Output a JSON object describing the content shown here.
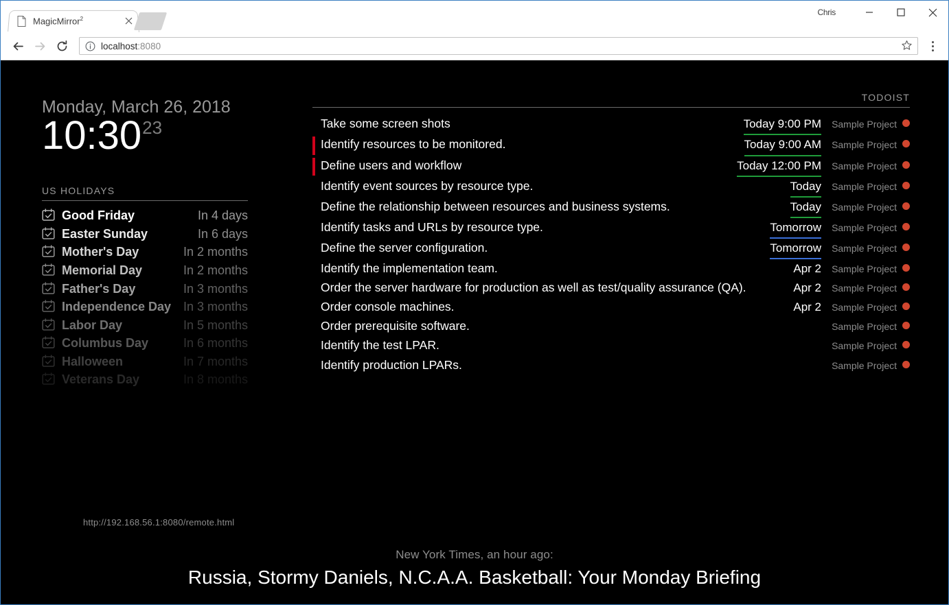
{
  "browser": {
    "tab": {
      "title": "MagicMirror",
      "superscript": "2",
      "page_icon": "page-icon",
      "close_icon": "close-icon"
    },
    "newtab_label": "",
    "profile_name": "Chris",
    "window_controls": {
      "minimize": "minimize-icon",
      "maximize": "maximize-icon",
      "close": "close-icon"
    },
    "toolbar": {
      "back_icon": "back-arrow-icon",
      "forward_icon": "forward-arrow-icon",
      "reload_icon": "reload-icon",
      "site_info_icon": "info-circle-icon",
      "url_host": "localhost",
      "url_port": ":8080",
      "bookmark_icon": "star-icon",
      "menu_icon": "three-dots-menu-icon"
    }
  },
  "mirror": {
    "clock": {
      "date": "Monday, March 26, 2018",
      "time": "10:30",
      "seconds": "23"
    },
    "calendar": {
      "header": "US Holidays",
      "icon_name": "calendar-check-icon",
      "events": [
        {
          "title": "Good Friday",
          "when": "In 4 days",
          "opacity": "1.00"
        },
        {
          "title": "Easter Sunday",
          "when": "In 6 days",
          "opacity": "0.92"
        },
        {
          "title": "Mother's Day",
          "when": "In 2 months",
          "opacity": "0.84"
        },
        {
          "title": "Memorial Day",
          "when": "In 2 months",
          "opacity": "0.75"
        },
        {
          "title": "Father's Day",
          "when": "In 3 months",
          "opacity": "0.64"
        },
        {
          "title": "Independence Day",
          "when": "In 3 months",
          "opacity": "0.53"
        },
        {
          "title": "Labor Day",
          "when": "In 5 months",
          "opacity": "0.43"
        },
        {
          "title": "Columbus Day",
          "when": "In 6 months",
          "opacity": "0.34"
        },
        {
          "title": "Halloween",
          "when": "In 7 months",
          "opacity": "0.25"
        },
        {
          "title": "Veterans Day",
          "when": "In 8 months",
          "opacity": "0.16"
        }
      ]
    },
    "remote_url": "http://192.168.56.1:8080/remote.html",
    "todoist": {
      "header": "Todoist",
      "project_dot_color": "#d1462f",
      "today_underline_color": "#1f9c3a",
      "tomorrow_underline_color": "#3a6fd8",
      "overdue_flag_color": "#d0021b",
      "tasks": [
        {
          "title": "Take some screen shots",
          "due": "Today 9:00 PM",
          "due_style": "today",
          "project": "Sample Project",
          "overdue": "false"
        },
        {
          "title": "Identify resources to be monitored.",
          "due": "Today 9:00 AM",
          "due_style": "today",
          "project": "Sample Project",
          "overdue": "true"
        },
        {
          "title": "Define users and workflow",
          "due": "Today 12:00 PM",
          "due_style": "today",
          "project": "Sample Project",
          "overdue": "true"
        },
        {
          "title": "Identify event sources by resource type.",
          "due": "Today",
          "due_style": "today",
          "project": "Sample Project",
          "overdue": "false"
        },
        {
          "title": "Define the relationship between resources and business systems.",
          "due": "Today",
          "due_style": "today",
          "project": "Sample Project",
          "overdue": "false"
        },
        {
          "title": "Identify tasks and URLs by resource type.",
          "due": "Tomorrow",
          "due_style": "tomorrow",
          "project": "Sample Project",
          "overdue": "false"
        },
        {
          "title": "Define the server configuration.",
          "due": "Tomorrow",
          "due_style": "tomorrow",
          "project": "Sample Project",
          "overdue": "false"
        },
        {
          "title": "Identify the implementation team.",
          "due": "Apr 2",
          "due_style": "none",
          "project": "Sample Project",
          "overdue": "false"
        },
        {
          "title": "Order the server hardware for production as well as test/quality assurance (QA).",
          "due": "Apr 2",
          "due_style": "none",
          "project": "Sample Project",
          "overdue": "false"
        },
        {
          "title": "Order console machines.",
          "due": "Apr 2",
          "due_style": "none",
          "project": "Sample Project",
          "overdue": "false"
        },
        {
          "title": "Order prerequisite software.",
          "due": "",
          "due_style": "none",
          "project": "Sample Project",
          "overdue": "false"
        },
        {
          "title": "Identify the test LPAR.",
          "due": "",
          "due_style": "none",
          "project": "Sample Project",
          "overdue": "false"
        },
        {
          "title": "Identify production LPARs.",
          "due": "",
          "due_style": "none",
          "project": "Sample Project",
          "overdue": "false"
        }
      ]
    },
    "newsfeed": {
      "source": "New York Times, an hour ago:",
      "title": "Russia, Stormy Daniels, N.C.A.A. Basketball: Your Monday Briefing"
    }
  }
}
